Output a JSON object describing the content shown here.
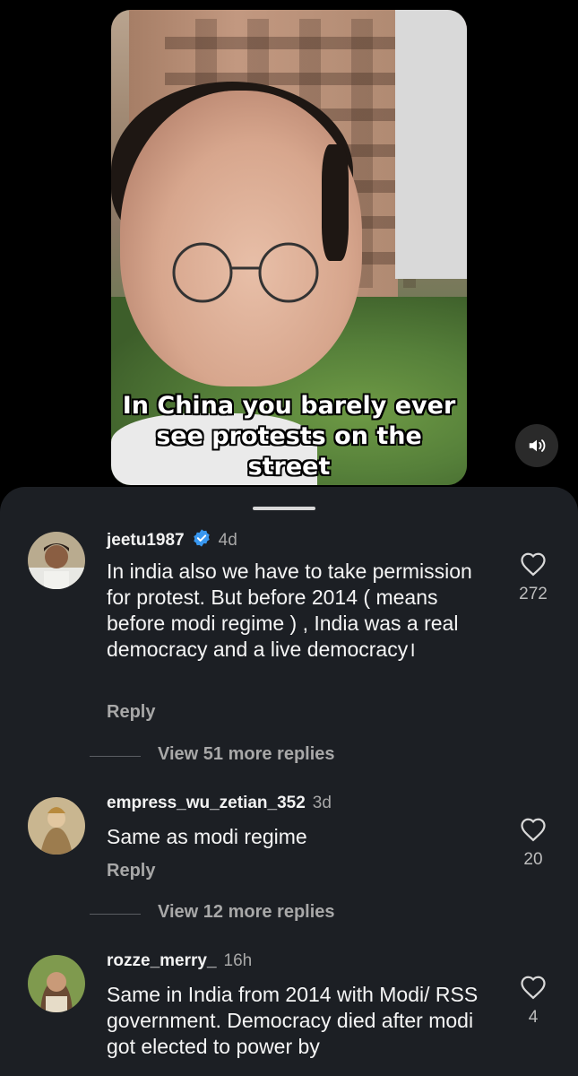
{
  "video": {
    "caption_lines": [
      "In China you barely ever",
      "see protests on the",
      "street"
    ],
    "volume_icon": "volume-on-icon"
  },
  "comments": [
    {
      "username": "jeetu1987",
      "verified": true,
      "time": "4d",
      "text": "In india also we have to take permission for protest. But before 2014 (  means before modi regime ) , India was a real democracy and a live democracy।",
      "reply_label": "Reply",
      "likes": "272",
      "view_replies": "View 51 more replies"
    },
    {
      "username": "empress_wu_zetian_352",
      "verified": false,
      "time": "3d",
      "text": "Same as modi regime",
      "reply_label": "Reply",
      "likes": "20",
      "view_replies": "View 12 more replies"
    },
    {
      "username": "rozze_merry_",
      "verified": false,
      "time": "16h",
      "text": "Same in India from 2014 with Modi/ RSS government. Democracy died after modi got elected to power by",
      "likes": "4"
    }
  ],
  "colors": {
    "sheet_bg": "#1c1f24",
    "verified_blue": "#3897f0",
    "secondary_text": "#a8a8a8"
  }
}
